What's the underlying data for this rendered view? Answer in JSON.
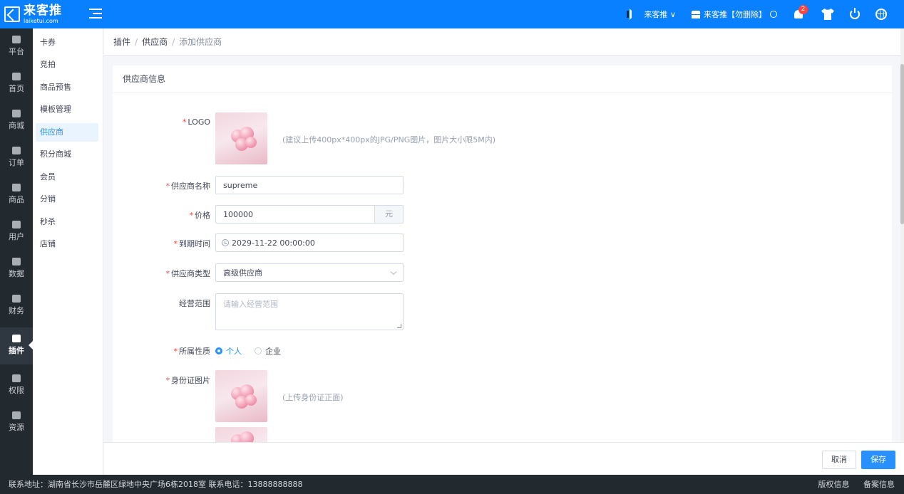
{
  "header": {
    "logo_name": "来客推",
    "logo_domain": "laiketui.com",
    "store_switch": "来客推 ∨",
    "store_name": "来客推【勿删除】",
    "notifications": "2"
  },
  "sidebar": {
    "items": [
      {
        "label": "平台",
        "icon": "platform-icon"
      },
      {
        "label": "首页",
        "icon": "home-icon"
      },
      {
        "label": "商城",
        "icon": "mall-icon"
      },
      {
        "label": "订单",
        "icon": "order-icon"
      },
      {
        "label": "商品",
        "icon": "goods-icon"
      },
      {
        "label": "用户",
        "icon": "user-icon"
      },
      {
        "label": "数据",
        "icon": "chart-icon"
      },
      {
        "label": "财务",
        "icon": "finance-icon"
      },
      {
        "label": "插件",
        "icon": "plugin-icon",
        "active": true
      },
      {
        "label": "权限",
        "icon": "shield-icon"
      },
      {
        "label": "资源",
        "icon": "image-icon"
      }
    ]
  },
  "subnav": {
    "items": [
      "卡券",
      "竞拍",
      "商品预售",
      "模板管理",
      "供应商",
      "积分商城",
      "会员",
      "分销",
      "秒杀",
      "店铺"
    ],
    "active": "供应商"
  },
  "breadcrumb": [
    "插件",
    "供应商",
    "添加供应商"
  ],
  "card": {
    "title": "供应商信息"
  },
  "form": {
    "logo": {
      "label": "LOGO",
      "hint": "(建议上传400px*400px的JPG/PNG图片，图片大小限5M内)"
    },
    "name": {
      "label": "供应商名称",
      "value": "supreme"
    },
    "price": {
      "label": "价格",
      "value": "100000",
      "suffix": "元"
    },
    "expire": {
      "label": "到期时间",
      "value": "2029-11-22 00:00:00"
    },
    "type": {
      "label": "供应商类型",
      "value": "高级供应商"
    },
    "scope": {
      "label": "经营范围",
      "placeholder": "请输入经营范围"
    },
    "nature": {
      "label": "所属性质",
      "options": [
        "个人",
        "企业"
      ],
      "selected": "个人"
    },
    "id_image": {
      "label": "身份证图片",
      "hint": "(上传身份证正面)"
    }
  },
  "actions": {
    "cancel": "取消",
    "save": "保存"
  },
  "footer": {
    "address": "联系地址：湖南省长沙市岳麓区绿地中央广场6栋2018室 联系电话：13888888888",
    "copyright": "版权信息",
    "icp": "备案信息"
  },
  "colors": {
    "header": "#0880ff",
    "sidebar": "#22292f",
    "accent": "#2890ff",
    "required": "#ff453d"
  }
}
